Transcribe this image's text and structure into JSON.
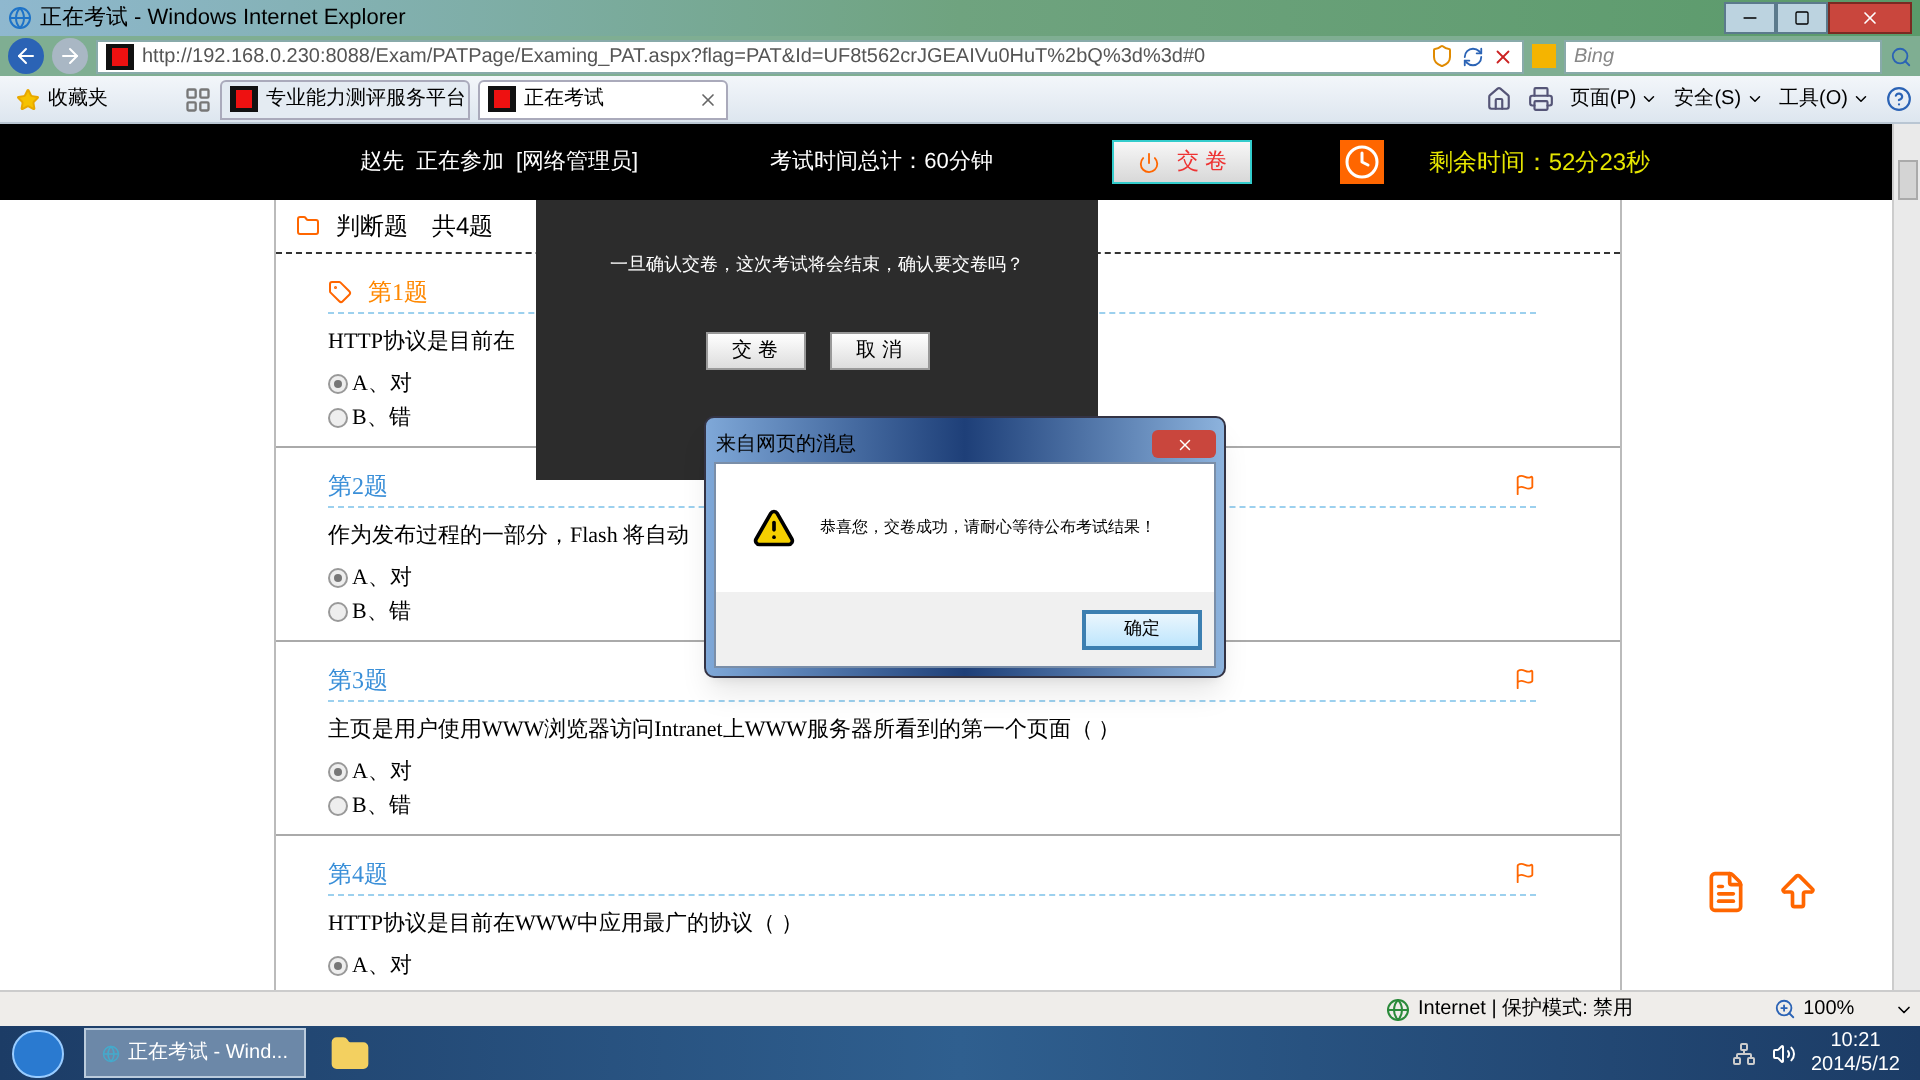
{
  "window": {
    "title": "正在考试 - Windows Internet Explorer"
  },
  "address_bar": {
    "url": "http://192.168.0.230:8088/Exam/PATPage/Examing_PAT.aspx?flag=PAT&Id=UF8t562crJGEAIVu0HuT%2bQ%3d%3d#0",
    "search_placeholder": "Bing"
  },
  "favorites_bar": {
    "favorites": "收藏夹",
    "tabs": [
      {
        "label": "专业能力测评服务平台",
        "selected": false
      },
      {
        "label": "正在考试",
        "selected": true
      }
    ],
    "menus": [
      "页面(P)",
      "安全(S)",
      "工具(O)"
    ]
  },
  "exam_header": {
    "candidate": "赵先",
    "status": "正在参加",
    "subject": "[网络管理员]",
    "total_time": "考试时间总计：60分钟",
    "submit_button": "交 卷",
    "remaining": "剩余时间：52分23秒"
  },
  "section": {
    "title": "判断题",
    "count": "共4题"
  },
  "questions": [
    {
      "number": "第1题",
      "current": true,
      "text": "HTTP协议是目前在",
      "options": [
        {
          "label": "A、对",
          "selected": true
        },
        {
          "label": "B、错",
          "selected": false
        }
      ]
    },
    {
      "number": "第2题",
      "current": false,
      "text": "作为发布过程的一部分，Flash 将自动",
      "options": [
        {
          "label": "A、对",
          "selected": true
        },
        {
          "label": "B、错",
          "selected": false
        }
      ]
    },
    {
      "number": "第3题",
      "current": false,
      "text": "主页是用户使用WWW浏览器访问Intranet上WWW服务器所看到的第一个页面（  ）",
      "options": [
        {
          "label": "A、对",
          "selected": true
        },
        {
          "label": "B、错",
          "selected": false
        }
      ]
    },
    {
      "number": "第4题",
      "current": false,
      "text": "HTTP协议是目前在WWW中应用最广的协议（  ）",
      "options": [
        {
          "label": "A、对",
          "selected": true
        }
      ]
    }
  ],
  "confirm_dialog": {
    "message": "一旦确认交卷，这次考试将会结束，确认要交卷吗？",
    "buttons": [
      "交 卷",
      "取 消"
    ]
  },
  "message_box": {
    "title": "来自网页的消息",
    "message": "恭喜您，交卷成功，请耐心等待公布考试结果！",
    "button": "确定"
  },
  "status_bar": {
    "zone": "Internet | 保护模式: 禁用",
    "zoom": "100%"
  },
  "taskbar": {
    "task": "正在考试 - Wind...",
    "time": "10:21",
    "date": "2014/5/12"
  }
}
